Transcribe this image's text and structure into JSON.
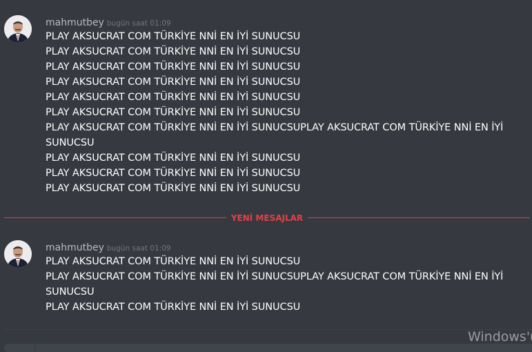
{
  "groups": [
    {
      "username": "mahmutbey",
      "timestamp": "bugün saat 01:09",
      "messages": [
        "PLAY AKSUCRAT COM TÜRKİYE NNİ EN İYİ SUNUCSU",
        "PLAY AKSUCRAT COM TÜRKİYE NNİ EN İYİ SUNUCSU",
        "PLAY AKSUCRAT COM TÜRKİYE NNİ EN İYİ SUNUCSU",
        "PLAY AKSUCRAT COM TÜRKİYE NNİ EN İYİ SUNUCSU",
        "PLAY AKSUCRAT COM TÜRKİYE NNİ EN İYİ SUNUCSU",
        "PLAY AKSUCRAT COM TÜRKİYE NNİ EN İYİ SUNUCSU",
        "PLAY AKSUCRAT COM TÜRKİYE NNİ EN İYİ SUNUCSUPLAY AKSUCRAT COM TÜRKİYE NNİ EN İYİ SUNUCSU",
        "PLAY AKSUCRAT COM TÜRKİYE NNİ EN İYİ SUNUCSU",
        "PLAY AKSUCRAT COM TÜRKİYE NNİ EN İYİ SUNUCSU",
        "PLAY AKSUCRAT COM TÜRKİYE NNİ EN İYİ SUNUCSU"
      ]
    },
    {
      "username": "mahmutbey",
      "timestamp": "bugün saat 01:09",
      "messages": [
        "PLAY AKSUCRAT COM TÜRKİYE NNİ EN İYİ SUNUCSU",
        "PLAY AKSUCRAT COM TÜRKİYE NNİ EN İYİ SUNUCSUPLAY AKSUCRAT COM TÜRKİYE NNİ EN İYİ SUNUCSU",
        "PLAY AKSUCRAT COM TÜRKİYE NNİ EN İYİ SUNUCSU"
      ]
    }
  ],
  "divider": {
    "label": "YENİ MESAJLAR"
  },
  "watermark": "Windows'u",
  "colors": {
    "background": "#36393f",
    "new_messages": "#e04146",
    "text": "#ffffff",
    "username": "#b9bbbe"
  }
}
